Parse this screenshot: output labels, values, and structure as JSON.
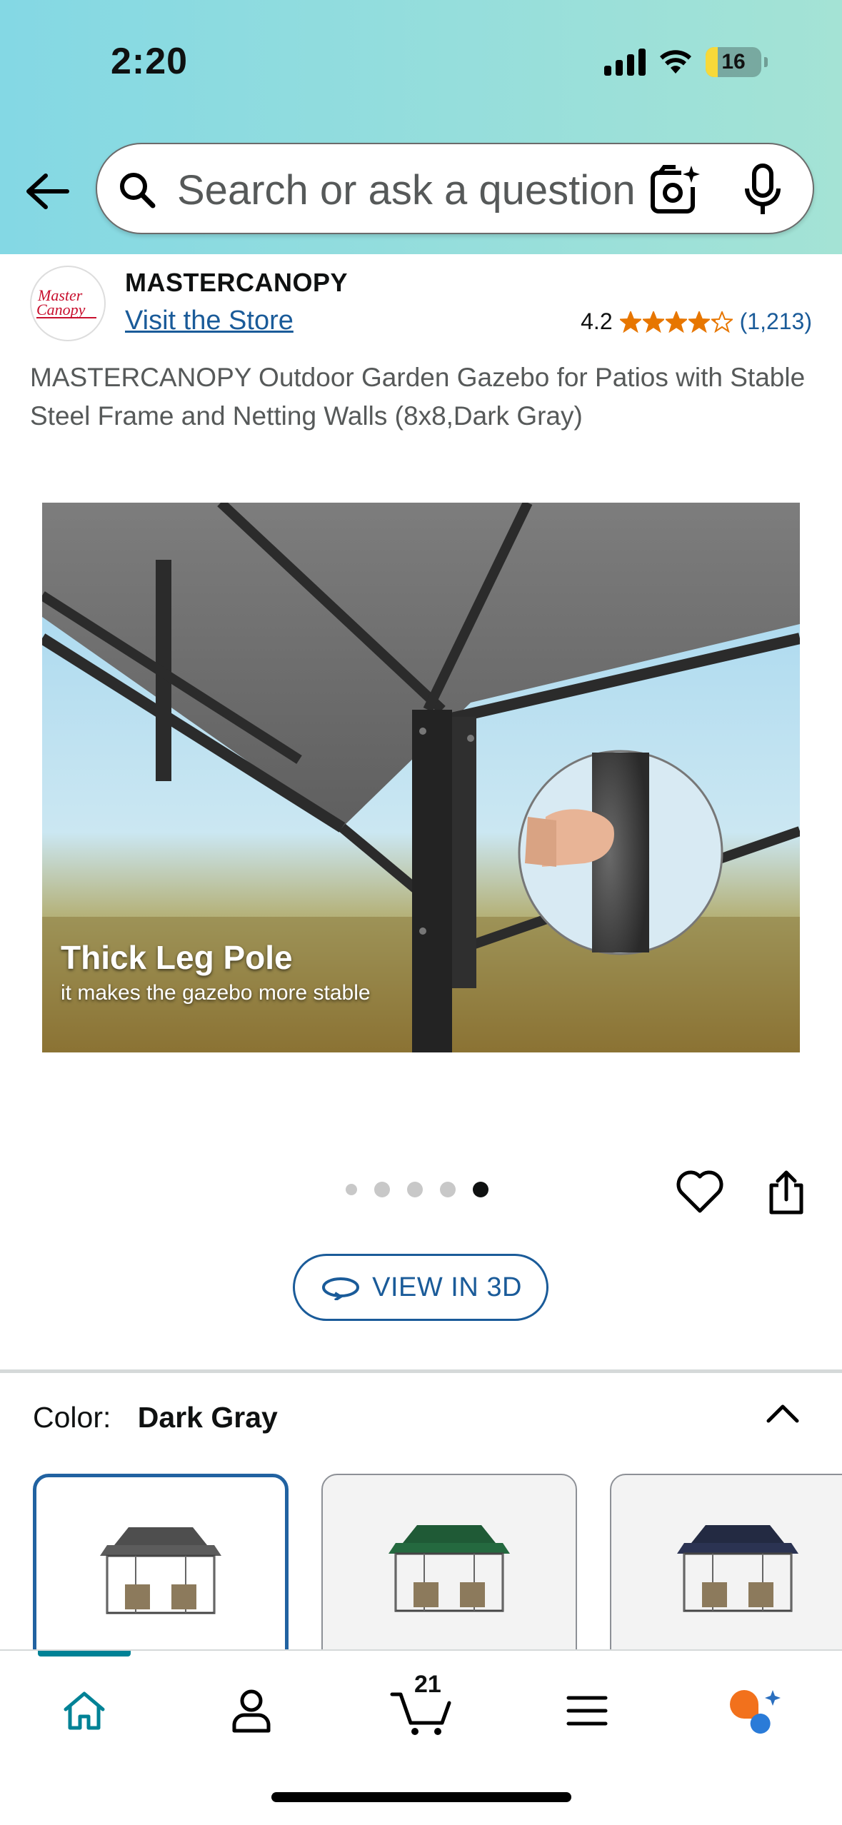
{
  "status_bar": {
    "time": "2:20",
    "battery_level": "16"
  },
  "search": {
    "placeholder": "Search or ask a question"
  },
  "brand": {
    "name": "MASTERCANOPY",
    "visit_store": "Visit the Store",
    "rating": "4.2",
    "rating_stars": 4.2,
    "review_count": "(1,213)"
  },
  "product": {
    "title": "MASTERCANOPY Outdoor Garden Gazebo for Patios with Stable Steel Frame and Netting Walls (8x8,Dark Gray)",
    "image_caption_title": "Thick Leg Pole",
    "image_caption_sub": "it makes the gazebo more stable",
    "carousel": {
      "total": 5,
      "active": 5
    }
  },
  "actions": {
    "view_in_3d": "VIEW IN 3D"
  },
  "color": {
    "label": "Color:",
    "selected": "Dark Gray",
    "options": [
      "Dark Gray",
      "Green",
      "Navy Blue"
    ]
  },
  "bottom_nav": {
    "cart_count": "21",
    "items": [
      "home",
      "account",
      "cart",
      "menu",
      "rufus"
    ]
  },
  "colors": {
    "header_gradient_start": "#84d8e4",
    "header_gradient_end": "#a4e3d5",
    "link": "#1a5b99",
    "star": "#e77600",
    "nav_active": "#008296"
  }
}
